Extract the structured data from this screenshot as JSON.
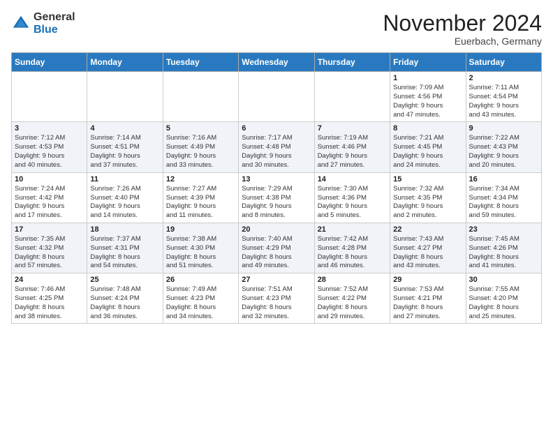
{
  "logo": {
    "general": "General",
    "blue": "Blue"
  },
  "header": {
    "month": "November 2024",
    "location": "Euerbach, Germany"
  },
  "weekdays": [
    "Sunday",
    "Monday",
    "Tuesday",
    "Wednesday",
    "Thursday",
    "Friday",
    "Saturday"
  ],
  "weeks": [
    [
      {
        "day": "",
        "info": ""
      },
      {
        "day": "",
        "info": ""
      },
      {
        "day": "",
        "info": ""
      },
      {
        "day": "",
        "info": ""
      },
      {
        "day": "",
        "info": ""
      },
      {
        "day": "1",
        "info": "Sunrise: 7:09 AM\nSunset: 4:56 PM\nDaylight: 9 hours\nand 47 minutes."
      },
      {
        "day": "2",
        "info": "Sunrise: 7:11 AM\nSunset: 4:54 PM\nDaylight: 9 hours\nand 43 minutes."
      }
    ],
    [
      {
        "day": "3",
        "info": "Sunrise: 7:12 AM\nSunset: 4:53 PM\nDaylight: 9 hours\nand 40 minutes."
      },
      {
        "day": "4",
        "info": "Sunrise: 7:14 AM\nSunset: 4:51 PM\nDaylight: 9 hours\nand 37 minutes."
      },
      {
        "day": "5",
        "info": "Sunrise: 7:16 AM\nSunset: 4:49 PM\nDaylight: 9 hours\nand 33 minutes."
      },
      {
        "day": "6",
        "info": "Sunrise: 7:17 AM\nSunset: 4:48 PM\nDaylight: 9 hours\nand 30 minutes."
      },
      {
        "day": "7",
        "info": "Sunrise: 7:19 AM\nSunset: 4:46 PM\nDaylight: 9 hours\nand 27 minutes."
      },
      {
        "day": "8",
        "info": "Sunrise: 7:21 AM\nSunset: 4:45 PM\nDaylight: 9 hours\nand 24 minutes."
      },
      {
        "day": "9",
        "info": "Sunrise: 7:22 AM\nSunset: 4:43 PM\nDaylight: 9 hours\nand 20 minutes."
      }
    ],
    [
      {
        "day": "10",
        "info": "Sunrise: 7:24 AM\nSunset: 4:42 PM\nDaylight: 9 hours\nand 17 minutes."
      },
      {
        "day": "11",
        "info": "Sunrise: 7:26 AM\nSunset: 4:40 PM\nDaylight: 9 hours\nand 14 minutes."
      },
      {
        "day": "12",
        "info": "Sunrise: 7:27 AM\nSunset: 4:39 PM\nDaylight: 9 hours\nand 11 minutes."
      },
      {
        "day": "13",
        "info": "Sunrise: 7:29 AM\nSunset: 4:38 PM\nDaylight: 9 hours\nand 8 minutes."
      },
      {
        "day": "14",
        "info": "Sunrise: 7:30 AM\nSunset: 4:36 PM\nDaylight: 9 hours\nand 5 minutes."
      },
      {
        "day": "15",
        "info": "Sunrise: 7:32 AM\nSunset: 4:35 PM\nDaylight: 9 hours\nand 2 minutes."
      },
      {
        "day": "16",
        "info": "Sunrise: 7:34 AM\nSunset: 4:34 PM\nDaylight: 8 hours\nand 59 minutes."
      }
    ],
    [
      {
        "day": "17",
        "info": "Sunrise: 7:35 AM\nSunset: 4:32 PM\nDaylight: 8 hours\nand 57 minutes."
      },
      {
        "day": "18",
        "info": "Sunrise: 7:37 AM\nSunset: 4:31 PM\nDaylight: 8 hours\nand 54 minutes."
      },
      {
        "day": "19",
        "info": "Sunrise: 7:38 AM\nSunset: 4:30 PM\nDaylight: 8 hours\nand 51 minutes."
      },
      {
        "day": "20",
        "info": "Sunrise: 7:40 AM\nSunset: 4:29 PM\nDaylight: 8 hours\nand 49 minutes."
      },
      {
        "day": "21",
        "info": "Sunrise: 7:42 AM\nSunset: 4:28 PM\nDaylight: 8 hours\nand 46 minutes."
      },
      {
        "day": "22",
        "info": "Sunrise: 7:43 AM\nSunset: 4:27 PM\nDaylight: 8 hours\nand 43 minutes."
      },
      {
        "day": "23",
        "info": "Sunrise: 7:45 AM\nSunset: 4:26 PM\nDaylight: 8 hours\nand 41 minutes."
      }
    ],
    [
      {
        "day": "24",
        "info": "Sunrise: 7:46 AM\nSunset: 4:25 PM\nDaylight: 8 hours\nand 38 minutes."
      },
      {
        "day": "25",
        "info": "Sunrise: 7:48 AM\nSunset: 4:24 PM\nDaylight: 8 hours\nand 36 minutes."
      },
      {
        "day": "26",
        "info": "Sunrise: 7:49 AM\nSunset: 4:23 PM\nDaylight: 8 hours\nand 34 minutes."
      },
      {
        "day": "27",
        "info": "Sunrise: 7:51 AM\nSunset: 4:23 PM\nDaylight: 8 hours\nand 32 minutes."
      },
      {
        "day": "28",
        "info": "Sunrise: 7:52 AM\nSunset: 4:22 PM\nDaylight: 8 hours\nand 29 minutes."
      },
      {
        "day": "29",
        "info": "Sunrise: 7:53 AM\nSunset: 4:21 PM\nDaylight: 8 hours\nand 27 minutes."
      },
      {
        "day": "30",
        "info": "Sunrise: 7:55 AM\nSunset: 4:20 PM\nDaylight: 8 hours\nand 25 minutes."
      }
    ]
  ]
}
